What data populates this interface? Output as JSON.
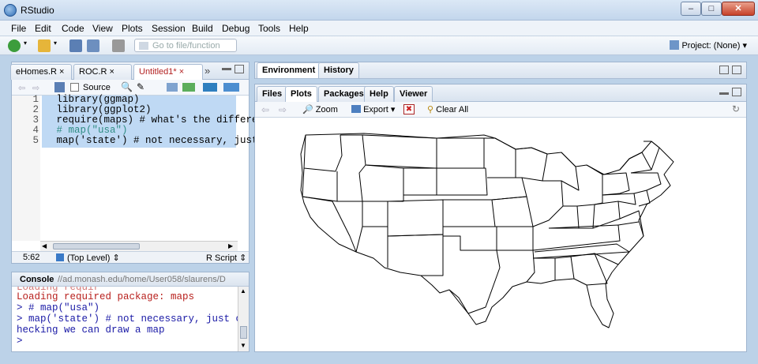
{
  "window": {
    "title": "RStudio",
    "min": "–",
    "max": "□",
    "close": "✕"
  },
  "menu": [
    "File",
    "Edit",
    "Code",
    "View",
    "Plots",
    "Session",
    "Build",
    "Debug",
    "Tools",
    "Help"
  ],
  "toolbar": {
    "goto_placeholder": "Go to file/function",
    "project": "Project: (None)"
  },
  "editor": {
    "tabs": [
      "eHomes.R",
      "ROC.R",
      "Untitled1*"
    ],
    "source_label": "Source",
    "lines": [
      {
        "n": "1",
        "text": "library(ggmap)"
      },
      {
        "n": "2",
        "text": "library(ggplot2)"
      },
      {
        "n": "3",
        "text": "require(maps) # what's the differe"
      },
      {
        "n": "4",
        "text": "# map(\"usa\")"
      },
      {
        "n": "5",
        "text": "map('state') # not necessary, just"
      }
    ],
    "status": {
      "position": "5:62",
      "scope": "(Top Level)",
      "type": "R Script"
    }
  },
  "console": {
    "title": "Console",
    "path": "//ad.monash.edu/home/User058/slaurens/D",
    "lines": [
      {
        "cls": "red",
        "text": "Loading required package: maps"
      },
      {
        "cls": "blue",
        "text": "> # map(\"usa\")"
      },
      {
        "cls": "blue",
        "text": "> map('state') # not necessary, just c"
      },
      {
        "cls": "blue",
        "text": "hecking we can draw a map"
      },
      {
        "cls": "blue",
        "text": "> "
      }
    ]
  },
  "env_pane": {
    "tabs": [
      "Environment",
      "History"
    ]
  },
  "plots_pane": {
    "tabs": [
      "Files",
      "Plots",
      "Packages",
      "Help",
      "Viewer"
    ],
    "zoom": "Zoom",
    "export": "Export",
    "clear_all": "Clear All"
  }
}
